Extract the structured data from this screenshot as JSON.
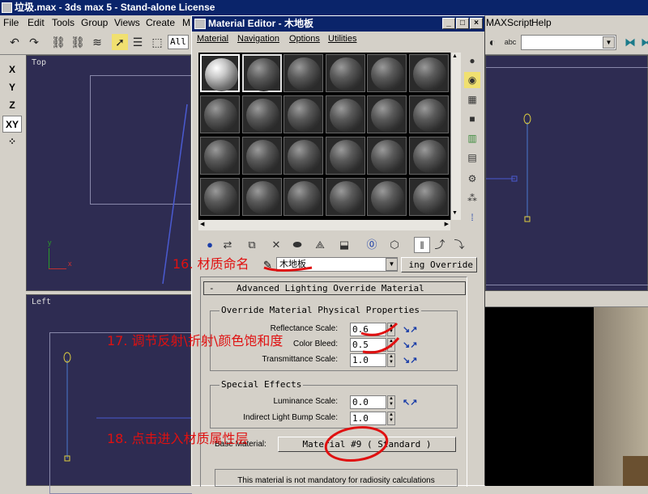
{
  "main_window": {
    "title": "垃圾.max - 3ds max 5 - Stand-alone License",
    "menu": [
      "File",
      "Edit",
      "Tools",
      "Group",
      "Views",
      "Create",
      "M"
    ],
    "right_menu": [
      "MAXScript",
      "Help"
    ],
    "selection_filter": "All",
    "axis_buttons": [
      "X",
      "Y",
      "Z",
      "XY"
    ],
    "viewports": {
      "top_label": "Top",
      "left_label": "Left"
    },
    "axis_tripod": {
      "y": "y",
      "x": "x"
    }
  },
  "material_editor": {
    "title": "Material Editor - 木地板",
    "window_buttons": {
      "minimize": "_",
      "maximize": "□",
      "close": "×"
    },
    "menu": [
      "Material",
      "Navigation",
      "Options",
      "Utilities"
    ],
    "slot_rows": 4,
    "slot_cols": 6,
    "material_name": "木地板",
    "type_button": "ing Override",
    "rollout": {
      "toggle": "-",
      "title": "Advanced Lighting Override Material"
    },
    "physical_props": {
      "title": "Override Material Physical Properties",
      "reflectance_label": "Reflectance Scale:",
      "reflectance_value": "0.6",
      "color_bleed_label": "Color Bleed:",
      "color_bleed_value": "0.5",
      "transmittance_label": "Transmittance Scale:",
      "transmittance_value": "1.0"
    },
    "special_effects": {
      "title": "Special Effects",
      "luminance_label": "Luminance Scale:",
      "luminance_value": "0.0",
      "bump_label": "Indirect Light Bump Scale:",
      "bump_value": "1.0"
    },
    "base_material_label": "Base Material:",
    "base_material_button": "Material #9  ( Standard )",
    "info_text": "This material is not mandatory for radiosity calculations"
  },
  "annotations": {
    "step16": "16. 材质命名",
    "step17": "17. 调节反射\\折射\\颜色饱和度",
    "step18": "18. 点击进入材质属性层",
    "color": "#e01010"
  }
}
